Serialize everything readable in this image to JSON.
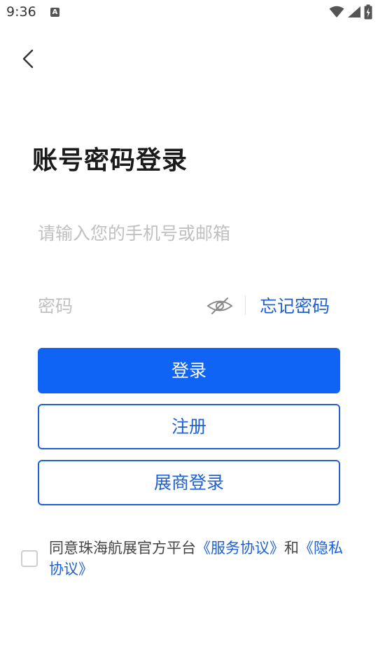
{
  "status_bar": {
    "time": "9:36",
    "notification_glyph": "A",
    "icons": [
      "wifi-icon",
      "signal-icon",
      "battery-charging-icon"
    ]
  },
  "header": {
    "back_icon": "chevron-left-icon"
  },
  "title": "账号密码登录",
  "account_field": {
    "value": "",
    "placeholder": "请输入您的手机号或邮箱"
  },
  "password_field": {
    "value": "",
    "placeholder": "密码",
    "visibility_icon": "eye-off-icon",
    "forgot_label": "忘记密码"
  },
  "buttons": {
    "login": "登录",
    "register": "注册",
    "exhibitor_login": "展商登录"
  },
  "agreement": {
    "checked": false,
    "prefix": "同意珠海航展官方平台",
    "service_link": "《服务协议》",
    "conjunction": "和",
    "privacy_link": "《隐私协议》"
  },
  "colors": {
    "accent": "#0f63f5",
    "link": "#1d5fd6",
    "placeholder": "#c0c0c0"
  }
}
